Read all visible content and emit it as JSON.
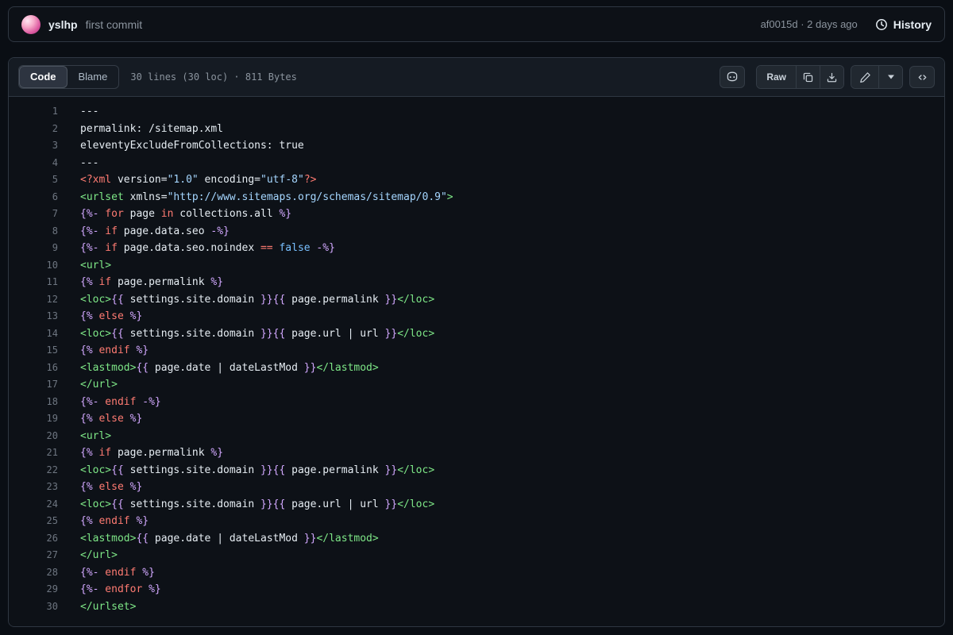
{
  "topbar": {
    "user": "yslhp",
    "commit_message": "first commit",
    "commit_sha": "af0015d",
    "separator": "·",
    "commit_time": "2 days ago",
    "history_label": "History",
    "icons": {
      "history": "history-clock-icon"
    }
  },
  "toolbar": {
    "tabs": {
      "code": "Code",
      "blame": "Blame"
    },
    "meta": "30 lines (30 loc) · 811 Bytes",
    "raw_label": "Raw",
    "icons": {
      "copilot": "copilot-icon",
      "copy": "copy-icon",
      "download": "download-icon",
      "edit": "pencil-icon",
      "edit_dropdown": "chevron-down-icon",
      "symbols": "code-symbols-icon"
    }
  },
  "colors": {
    "page_bg": "#0a0e14",
    "card_bg": "#0d1117",
    "header_bg": "#151b23",
    "border": "#2f3742",
    "muted_text": "#8b949e",
    "line_number": "#6e7681"
  },
  "code": {
    "token_colors": {
      "pln": "#e6edf3",
      "red": "#ff7b72",
      "grn": "#7ee787",
      "str": "#a5d6ff",
      "cst": "#79c0ff",
      "pur": "#d2a8ff"
    },
    "lines": [
      {
        "n": 1,
        "t": [
          [
            "pln",
            "---"
          ]
        ]
      },
      {
        "n": 2,
        "t": [
          [
            "pln",
            "permalink: /sitemap.xml"
          ]
        ]
      },
      {
        "n": 3,
        "t": [
          [
            "pln",
            "eleventyExcludeFromCollections: true"
          ]
        ]
      },
      {
        "n": 4,
        "t": [
          [
            "pln",
            "---"
          ]
        ]
      },
      {
        "n": 5,
        "t": [
          [
            "red",
            "<?xml"
          ],
          [
            "pln",
            " version="
          ],
          [
            "str",
            "\"1.0\""
          ],
          [
            "pln",
            " encoding="
          ],
          [
            "str",
            "\"utf-8\""
          ],
          [
            "red",
            "?>"
          ]
        ]
      },
      {
        "n": 6,
        "t": [
          [
            "grn",
            "<urlset"
          ],
          [
            "pln",
            " xmlns="
          ],
          [
            "str",
            "\"http://www.sitemaps.org/schemas/sitemap/0.9\""
          ],
          [
            "grn",
            ">"
          ]
        ]
      },
      {
        "n": 7,
        "t": [
          [
            "pur",
            "{%-"
          ],
          [
            "red",
            " for"
          ],
          [
            "pln",
            " page"
          ],
          [
            "red",
            " in"
          ],
          [
            "pln",
            " collections.all"
          ],
          [
            "pur",
            " %}"
          ]
        ]
      },
      {
        "n": 8,
        "t": [
          [
            "pur",
            "{%-"
          ],
          [
            "red",
            " if"
          ],
          [
            "pln",
            " page.data.seo"
          ],
          [
            "pur",
            " -%}"
          ]
        ]
      },
      {
        "n": 9,
        "t": [
          [
            "pur",
            "{%-"
          ],
          [
            "red",
            " if"
          ],
          [
            "pln",
            " page.data.seo.noindex"
          ],
          [
            "red",
            " =="
          ],
          [
            "cst",
            " false"
          ],
          [
            "pur",
            " -%}"
          ]
        ]
      },
      {
        "n": 10,
        "t": [
          [
            "grn",
            "<url>"
          ]
        ]
      },
      {
        "n": 11,
        "t": [
          [
            "pur",
            "{%"
          ],
          [
            "red",
            " if"
          ],
          [
            "pln",
            " page.permalink"
          ],
          [
            "pur",
            " %}"
          ]
        ]
      },
      {
        "n": 12,
        "t": [
          [
            "grn",
            "<loc>"
          ],
          [
            "pur",
            "{{"
          ],
          [
            "pln",
            " settings.site.domain "
          ],
          [
            "pur",
            "}}"
          ],
          [
            "pur",
            "{{"
          ],
          [
            "pln",
            " page.permalink "
          ],
          [
            "pur",
            "}}"
          ],
          [
            "grn",
            "</loc>"
          ]
        ]
      },
      {
        "n": 13,
        "t": [
          [
            "pur",
            "{%"
          ],
          [
            "red",
            " else"
          ],
          [
            "pur",
            " %}"
          ]
        ]
      },
      {
        "n": 14,
        "t": [
          [
            "grn",
            "<loc>"
          ],
          [
            "pur",
            "{{"
          ],
          [
            "pln",
            " settings.site.domain "
          ],
          [
            "pur",
            "}}"
          ],
          [
            "pur",
            "{{"
          ],
          [
            "pln",
            " page.url | url "
          ],
          [
            "pur",
            "}}"
          ],
          [
            "grn",
            "</loc>"
          ]
        ]
      },
      {
        "n": 15,
        "t": [
          [
            "pur",
            "{%"
          ],
          [
            "red",
            " endif"
          ],
          [
            "pur",
            " %}"
          ]
        ]
      },
      {
        "n": 16,
        "t": [
          [
            "grn",
            "<lastmod>"
          ],
          [
            "pur",
            "{{"
          ],
          [
            "pln",
            " page.date | dateLastMod "
          ],
          [
            "pur",
            "}}"
          ],
          [
            "grn",
            "</lastmod>"
          ]
        ]
      },
      {
        "n": 17,
        "t": [
          [
            "grn",
            "</url>"
          ]
        ]
      },
      {
        "n": 18,
        "t": [
          [
            "pur",
            "{%-"
          ],
          [
            "red",
            " endif"
          ],
          [
            "pur",
            " -%}"
          ]
        ]
      },
      {
        "n": 19,
        "t": [
          [
            "pur",
            "{%"
          ],
          [
            "red",
            " else"
          ],
          [
            "pur",
            " %}"
          ]
        ]
      },
      {
        "n": 20,
        "t": [
          [
            "grn",
            "<url>"
          ]
        ]
      },
      {
        "n": 21,
        "t": [
          [
            "pur",
            "{%"
          ],
          [
            "red",
            " if"
          ],
          [
            "pln",
            " page.permalink"
          ],
          [
            "pur",
            " %}"
          ]
        ]
      },
      {
        "n": 22,
        "t": [
          [
            "grn",
            "<loc>"
          ],
          [
            "pur",
            "{{"
          ],
          [
            "pln",
            " settings.site.domain "
          ],
          [
            "pur",
            "}}"
          ],
          [
            "pur",
            "{{"
          ],
          [
            "pln",
            " page.permalink "
          ],
          [
            "pur",
            "}}"
          ],
          [
            "grn",
            "</loc>"
          ]
        ]
      },
      {
        "n": 23,
        "t": [
          [
            "pur",
            "{%"
          ],
          [
            "red",
            " else"
          ],
          [
            "pur",
            " %}"
          ]
        ]
      },
      {
        "n": 24,
        "t": [
          [
            "grn",
            "<loc>"
          ],
          [
            "pur",
            "{{"
          ],
          [
            "pln",
            " settings.site.domain "
          ],
          [
            "pur",
            "}}"
          ],
          [
            "pur",
            "{{"
          ],
          [
            "pln",
            " page.url | url "
          ],
          [
            "pur",
            "}}"
          ],
          [
            "grn",
            "</loc>"
          ]
        ]
      },
      {
        "n": 25,
        "t": [
          [
            "pur",
            "{%"
          ],
          [
            "red",
            " endif"
          ],
          [
            "pur",
            " %}"
          ]
        ]
      },
      {
        "n": 26,
        "t": [
          [
            "grn",
            "<lastmod>"
          ],
          [
            "pur",
            "{{"
          ],
          [
            "pln",
            " page.date | dateLastMod "
          ],
          [
            "pur",
            "}}"
          ],
          [
            "grn",
            "</lastmod>"
          ]
        ]
      },
      {
        "n": 27,
        "t": [
          [
            "grn",
            "</url>"
          ]
        ]
      },
      {
        "n": 28,
        "t": [
          [
            "pur",
            "{%-"
          ],
          [
            "red",
            " endif"
          ],
          [
            "pur",
            " %}"
          ]
        ]
      },
      {
        "n": 29,
        "t": [
          [
            "pur",
            "{%-"
          ],
          [
            "red",
            " endfor"
          ],
          [
            "pur",
            " %}"
          ]
        ]
      },
      {
        "n": 30,
        "t": [
          [
            "grn",
            "</urlset>"
          ]
        ]
      }
    ]
  }
}
